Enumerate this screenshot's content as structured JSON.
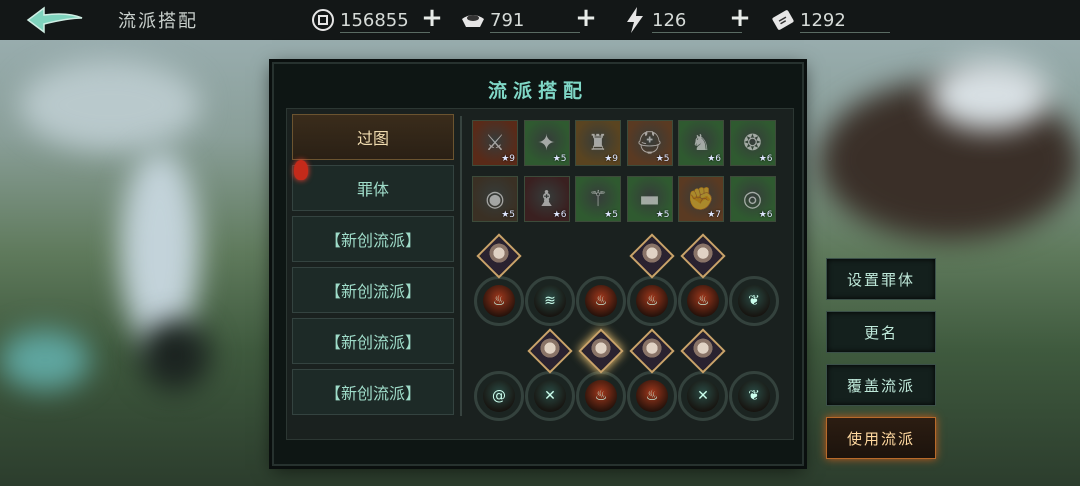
{
  "topbar": {
    "title": "流派搭配",
    "resources": [
      {
        "icon": "coin-icon",
        "value": "156855"
      },
      {
        "icon": "ingot-icon",
        "value": "791"
      },
      {
        "icon": "lightning-icon",
        "value": "126"
      },
      {
        "icon": "ticket-icon",
        "value": "1292"
      }
    ],
    "plus": "+"
  },
  "panel": {
    "title": "流派搭配",
    "tabs": [
      {
        "label": "过图",
        "active": true
      },
      {
        "label": "罪体",
        "active": false
      },
      {
        "label": "【新创流派】",
        "active": false
      },
      {
        "label": "【新创流派】",
        "active": false
      },
      {
        "label": "【新创流派】",
        "active": false
      },
      {
        "label": "【新创流派】",
        "active": false
      }
    ],
    "equipment_rows": [
      [
        {
          "icon": "red-sword-icon",
          "level": "9",
          "color": "#5a2a18"
        },
        {
          "icon": "claw-icon",
          "level": "5",
          "color": "#2f5a30"
        },
        {
          "icon": "dark-armor-icon",
          "level": "9",
          "color": "#5a4420"
        },
        {
          "icon": "helmet-icon",
          "level": "5",
          "color": "#5a3a22"
        },
        {
          "icon": "boots-icon",
          "level": "6",
          "color": "#2f5a30"
        },
        {
          "icon": "amulet-icon",
          "level": "6",
          "color": "#2f5a30"
        }
      ],
      [
        {
          "icon": "blue-orb-icon",
          "level": "5",
          "color": "#3a3024"
        },
        {
          "icon": "red-cloak-icon",
          "level": "6",
          "color": "#3a2020"
        },
        {
          "icon": "staff-icon",
          "level": "5",
          "color": "#2f5a30"
        },
        {
          "icon": "belt-icon",
          "level": "5",
          "color": "#2f5a30"
        },
        {
          "icon": "gauntlet-icon",
          "level": "7",
          "color": "#5a3a22"
        },
        {
          "icon": "ring-icon",
          "level": "6",
          "color": "#2f5a30"
        }
      ]
    ],
    "skill_rows": [
      [
        {
          "icon": "fire-slot-icon",
          "color": "#a0381c",
          "has_char": true
        },
        {
          "icon": "wave-slot-icon",
          "color": "#2a4a44",
          "has_char": false
        },
        {
          "icon": "flame-slot-icon",
          "color": "#a0381c",
          "has_char": false
        },
        {
          "icon": "fire-slot-icon",
          "color": "#a0381c",
          "has_char": true
        },
        {
          "icon": "fire-slot-icon",
          "color": "#a0381c",
          "has_char": true
        },
        {
          "icon": "spirit-slot-icon",
          "color": "#2a4a44",
          "has_char": false
        }
      ],
      [
        {
          "icon": "spiral-slot-icon",
          "color": "#2a4a44",
          "has_char": false
        },
        {
          "icon": "cross-slot-icon",
          "color": "#2a4a44",
          "has_char": true
        },
        {
          "icon": "fire-slot-icon",
          "color": "#a0381c",
          "has_char": true
        },
        {
          "icon": "fire-slot-icon",
          "color": "#a0381c",
          "has_char": true
        },
        {
          "icon": "cross-slot-icon",
          "color": "#2a4a44",
          "has_char": true
        },
        {
          "icon": "spirit-slot-icon",
          "color": "#2a4a44",
          "has_char": false
        }
      ]
    ]
  },
  "side_buttons": [
    {
      "label": "设置罪体",
      "primary": false
    },
    {
      "label": "更名",
      "primary": false
    },
    {
      "label": "覆盖流派",
      "primary": false
    },
    {
      "label": "使用流派",
      "primary": true
    }
  ]
}
